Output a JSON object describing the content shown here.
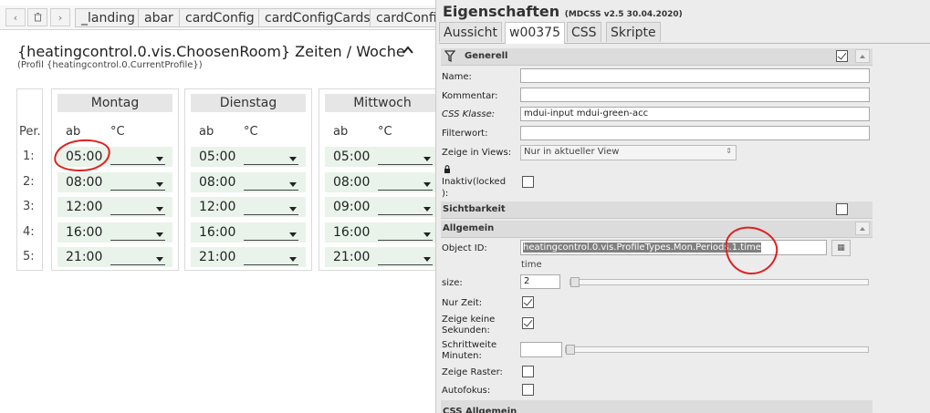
{
  "vis_tabs": [
    "_landing",
    "abar",
    "cardConfig",
    "cardConfigCards",
    "cardConfig"
  ],
  "card": {
    "title": "{heatingcontrol.0.vis.ChoosenRoom} Zeiten / Woche",
    "subtitle": "(Profil {heatingcontrol.0.CurrentProfile})",
    "period_header": "Per.",
    "periods": [
      "1:",
      "2:",
      "3:",
      "4:",
      "5:"
    ],
    "col_from": "ab",
    "col_temp": "°C",
    "days": [
      {
        "name": "Montag",
        "times": [
          "05:00",
          "08:00",
          "12:00",
          "16:00",
          "21:00"
        ]
      },
      {
        "name": "Dienstag",
        "times": [
          "05:00",
          "08:00",
          "12:00",
          "16:00",
          "21:00"
        ]
      },
      {
        "name": "Mittwoch",
        "times": [
          "05:00",
          "08:00",
          "09:00",
          "16:00",
          "21:00"
        ]
      }
    ]
  },
  "panel": {
    "title": "Eigenschaften",
    "title_small": "(MDCSS v2.5 30.04.2020)",
    "tabs": [
      "Aussicht",
      "w00375",
      "CSS",
      "Skripte"
    ],
    "sections": {
      "generell": "Generell",
      "sichtbarkeit": "Sichtbarkeit",
      "allgemein": "Allgemein",
      "css_allgemein": "CSS Allgemein"
    },
    "fields": {
      "name": {
        "label": "Name:",
        "value": ""
      },
      "kommentar": {
        "label": "Kommentar:",
        "value": ""
      },
      "css_klasse": {
        "label": "CSS Klasse:",
        "value": "mdui-input mdui-green-acc"
      },
      "filterwort": {
        "label": "Filterwort:",
        "value": ""
      },
      "zeige_in_views": {
        "label": "Zeige in Views:",
        "value": "Nur in aktueller View"
      },
      "inaktiv": {
        "label": "Inaktiv(locked",
        "label2": "):"
      },
      "object_id": {
        "label": "Object ID:",
        "value": "heatingcontrol.0.vis.ProfileTypes.Mon.Periods.1.time",
        "hint": "time"
      },
      "size": {
        "label": "size:",
        "value": "2",
        "slider": 0
      },
      "nur_zeit": {
        "label": "Nur Zeit:",
        "checked": true
      },
      "zeige_keine_sekunden": {
        "label": "Zeige keine",
        "label2": "Sekunden:",
        "checked": true
      },
      "schrittweite": {
        "label": "Schrittweite",
        "label2": "Minuten:",
        "value": "",
        "slider": 0
      },
      "zeige_raster": {
        "label": "Zeige Raster:",
        "checked": false
      },
      "autofokus": {
        "label": "Autofokus:",
        "checked": false
      }
    }
  }
}
